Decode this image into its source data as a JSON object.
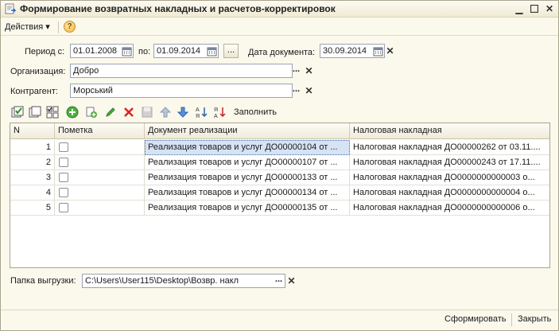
{
  "window": {
    "title": "Формирование возвратных накладных и расчетов-корректировок"
  },
  "menu": {
    "actions_label": "Действия ▾",
    "help_glyph": "?"
  },
  "filters": {
    "period_from_label": "Период с:",
    "period_from_value": "01.01.2008",
    "period_to_label": "по:",
    "period_to_value": "01.09.2014",
    "period_button": "...",
    "doc_date_label": "Дата документа:",
    "doc_date_value": "30.09.2014",
    "org_label": "Организация:",
    "org_value": "Добро",
    "contractor_label": "Контрагент:",
    "contractor_value": "Морський",
    "select_button": "..."
  },
  "toolbar": {
    "fill_label": "Заполнить"
  },
  "table": {
    "headers": [
      "N",
      "Пометка",
      "Документ реализации",
      "Налоговая накладная"
    ],
    "rows": [
      {
        "n": "1",
        "doc": "Реализация товаров и услуг ДО00000104 от ...",
        "tax": "Налоговая накладная ДО00000262 от 03.11...."
      },
      {
        "n": "2",
        "doc": "Реализация товаров и услуг ДО00000107 от ...",
        "tax": "Налоговая накладная ДО00000243 от 17.11...."
      },
      {
        "n": "3",
        "doc": "Реализация товаров и услуг ДО00000133 от ...",
        "tax": "Налоговая накладная ДО0000000000003 о..."
      },
      {
        "n": "4",
        "doc": "Реализация товаров и услуг ДО00000134 от ...",
        "tax": "Налоговая накладная ДО0000000000004 о..."
      },
      {
        "n": "5",
        "doc": "Реализация товаров и услуг ДО00000135 от ...",
        "tax": "Налоговая накладная ДО0000000000006 о..."
      }
    ]
  },
  "export": {
    "label": "Папка выгрузки:",
    "path": "C:\\Users\\User115\\Desktop\\Возвр. накл",
    "browse_button": "..."
  },
  "footer": {
    "generate_label": "Сформировать",
    "close_label": "Закрыть"
  },
  "colors": {
    "background": "#fbf8ec",
    "selection": "#d6e3f5",
    "border": "#9aa3b5"
  }
}
